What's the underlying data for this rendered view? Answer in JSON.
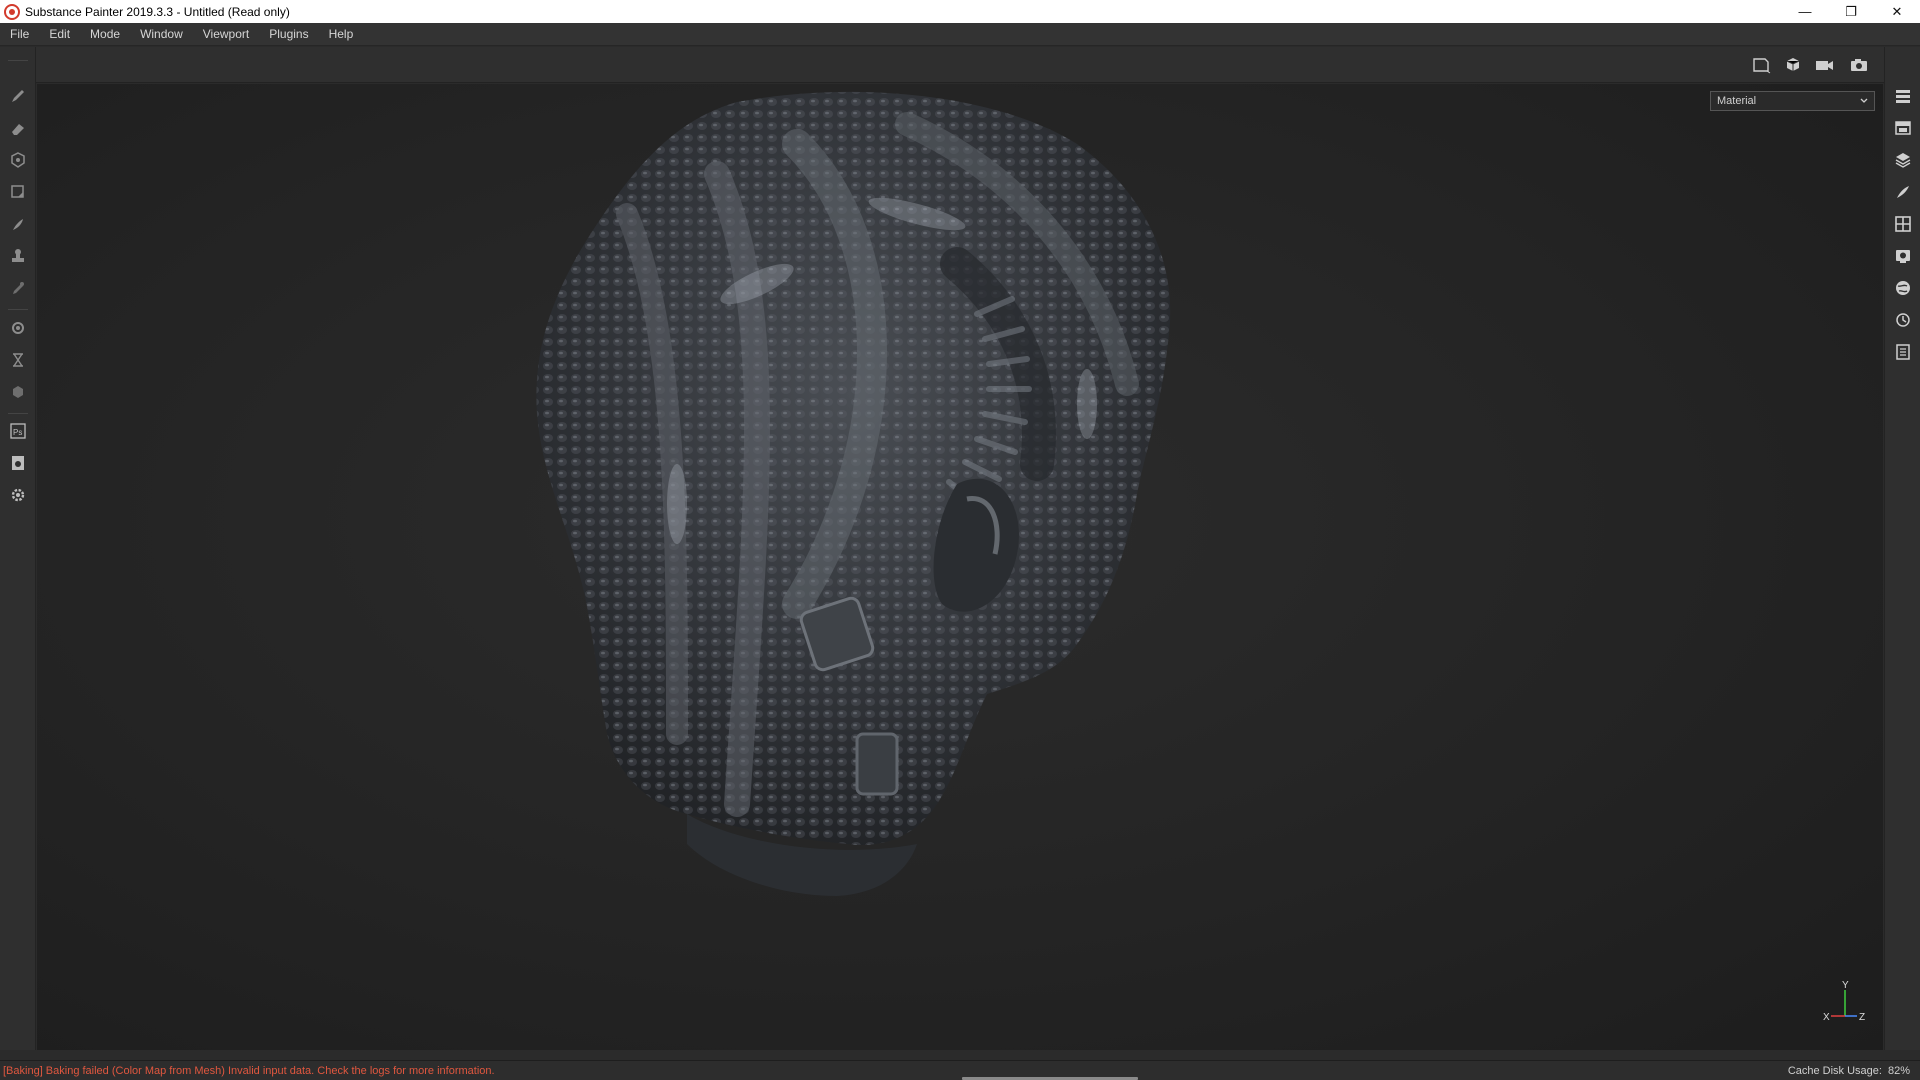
{
  "window": {
    "title": "Substance Painter 2019.3.3 - Untitled (Read only)",
    "minimize_glyph": "—",
    "restore_glyph": "❐",
    "close_glyph": "✕"
  },
  "menu": {
    "items": [
      "File",
      "Edit",
      "Mode",
      "Window",
      "Viewport",
      "Plugins",
      "Help"
    ]
  },
  "top_toolbar": {
    "icons": [
      "display-mode-icon",
      "view-cube-icon",
      "camera-icon",
      "screenshot-icon"
    ]
  },
  "left_tools": {
    "icons": [
      "paint-brush-icon",
      "eraser-icon",
      "projection-icon",
      "polygon-fill-icon",
      "smudge-icon",
      "clone-stamp-icon",
      "color-picker-icon",
      "bake-settings-icon",
      "hourglass-icon",
      "material-icon",
      "photoshop-icon",
      "export-icon",
      "settings-icon"
    ]
  },
  "right_tools": {
    "icons": [
      "layers-icon",
      "texture-set-list-icon",
      "layer-stack-icon",
      "brush-properties-icon",
      "uv-grid-icon",
      "display-settings-icon",
      "shelf-icon",
      "history-icon",
      "log-icon"
    ]
  },
  "viewport": {
    "channel_selected": "Material",
    "axis": {
      "y": "Y",
      "x": "X",
      "z": "Z"
    }
  },
  "status": {
    "message": "[Baking] Baking failed (Color Map from Mesh) Invalid input data. Check the logs for more information.",
    "cache_label": "Cache Disk Usage:",
    "cache_value": "82%"
  }
}
